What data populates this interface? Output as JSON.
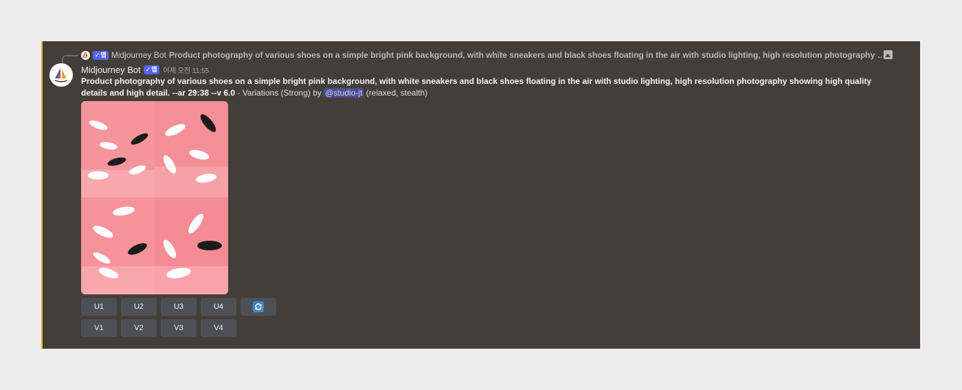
{
  "reply": {
    "author": "Midjourney Bot",
    "badge": "앱",
    "text": "Product photography of various shoes on a simple bright pink background, with white sneakers and black shoes floating in the air with studio lighting, high resolution photography showing high quality details a…"
  },
  "message": {
    "author": "Midjourney Bot",
    "badge": "앱",
    "timestamp": "어제 오전 11:55",
    "prompt": "Product photography of various shoes on a simple bright pink background, with white sneakers and black shoes floating in the air with studio lighting, high resolution photography showing high quality details and high detail. --ar 29:38 --v 6.0",
    "suffix": " - Variations (Strong) by ",
    "mention": "@studio-jt",
    "tail": " (relaxed, stealth)"
  },
  "buttons": {
    "upscale": [
      "U1",
      "U2",
      "U3",
      "U4"
    ],
    "variation": [
      "V1",
      "V2",
      "V3",
      "V4"
    ],
    "reroll_icon": "refresh-icon"
  },
  "colors": {
    "background": "#433f38",
    "accent_bar": "#f0b232",
    "badge": "#5865f2",
    "button": "#4e5058",
    "image_bg": "#f48a93"
  }
}
